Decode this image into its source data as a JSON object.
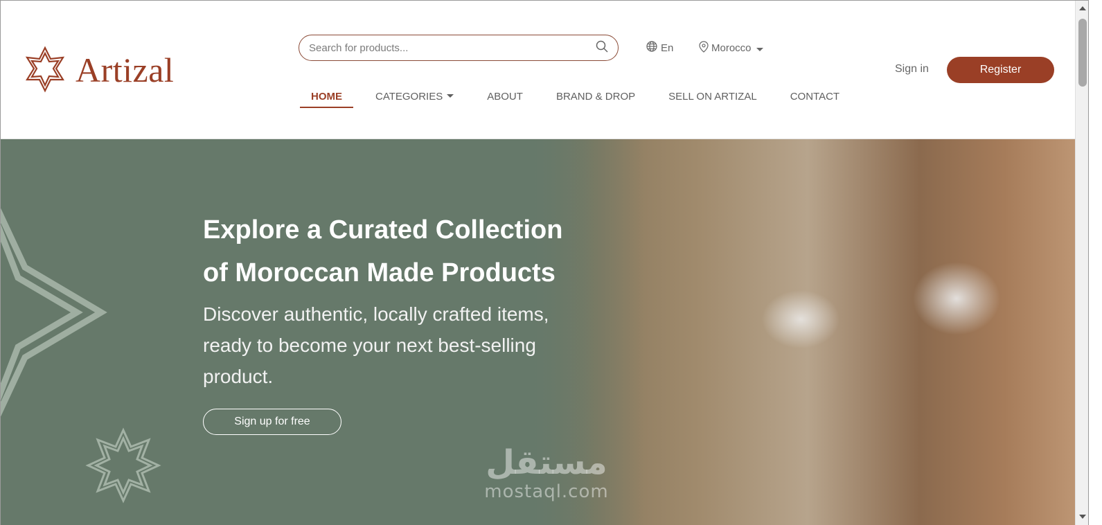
{
  "brand": {
    "name": "Artizal",
    "color": "#9a3f26",
    "icon": "star-logo-icon"
  },
  "search": {
    "placeholder": "Search for products...",
    "icon": "search-icon"
  },
  "language": {
    "label": "En",
    "icon": "globe-icon"
  },
  "country": {
    "label": "Morocco",
    "icon": "location-pin-icon"
  },
  "nav": {
    "items": [
      {
        "label": "HOME",
        "active": true
      },
      {
        "label": "CATEGORIES",
        "dropdown": true
      },
      {
        "label": "ABOUT"
      },
      {
        "label": "BRAND & DROP"
      },
      {
        "label": "SELL ON ARTIZAL"
      },
      {
        "label": "CONTACT"
      }
    ]
  },
  "auth": {
    "signin_label": "Sign in",
    "register_label": "Register"
  },
  "hero": {
    "title": "Explore a Curated Collection of Moroccan Made Products",
    "subtitle": "Discover authentic, locally crafted items, ready to become your next best-selling product.",
    "cta_label": "Sign up for free",
    "background_color": "#66796a"
  },
  "watermark": {
    "arabic": "مستقل",
    "latin": "mostaql.com"
  }
}
